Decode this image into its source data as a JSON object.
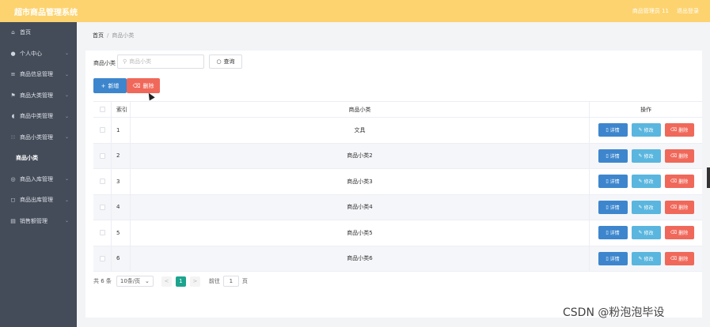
{
  "header": {
    "title": "超市商品管理系统",
    "user": "商品管理员 11",
    "logout": "退出登录",
    "color": "#fdd36f"
  },
  "sidebar": {
    "items": [
      {
        "label": "首页",
        "icon": "home-icon",
        "glyph": "⌂",
        "has_children": false
      },
      {
        "label": "个人中心",
        "icon": "user-icon",
        "glyph": "●",
        "has_children": true
      },
      {
        "label": "商品信息管理",
        "icon": "list-icon",
        "glyph": "≡",
        "has_children": true
      },
      {
        "label": "商品大类管理",
        "icon": "flag-icon",
        "glyph": "⚑",
        "has_children": true
      },
      {
        "label": "商品中类管理",
        "icon": "mic-icon",
        "glyph": "◖",
        "has_children": true
      },
      {
        "label": "商品小类管理",
        "icon": "grid-icon",
        "glyph": "∷",
        "has_children": true
      },
      {
        "label": "商品小类",
        "icon": "",
        "glyph": "",
        "has_children": false,
        "sub": true
      },
      {
        "label": "商品入库管理",
        "icon": "globe-icon",
        "glyph": "◎",
        "has_children": true
      },
      {
        "label": "商品出库管理",
        "icon": "chat-icon",
        "glyph": "◻",
        "has_children": true
      },
      {
        "label": "销售额管理",
        "icon": "clipboard-icon",
        "glyph": "▤",
        "has_children": true
      }
    ]
  },
  "breadcrumb": {
    "home": "首页",
    "separator": "/",
    "current": "商品小类"
  },
  "search": {
    "label": "商品小类",
    "placeholder": "商品小类",
    "query_button": "查询"
  },
  "actions": {
    "add": "新增",
    "delete": "删除"
  },
  "table": {
    "columns": [
      "索引",
      "商品小类",
      "操作"
    ],
    "rows": [
      {
        "index": "1",
        "name": "文具"
      },
      {
        "index": "2",
        "name": "商品小类2"
      },
      {
        "index": "3",
        "name": "商品小类3"
      },
      {
        "index": "4",
        "name": "商品小类4"
      },
      {
        "index": "5",
        "name": "商品小类5"
      },
      {
        "index": "6",
        "name": "商品小类6"
      }
    ],
    "row_actions": {
      "detail": "详情",
      "edit": "修改",
      "remove": "删除"
    }
  },
  "pagination": {
    "total": "共 6 条",
    "page_size": "10条/页",
    "prev": "<",
    "current_page": "1",
    "next": ">",
    "goto_label": "前往",
    "goto_value": "1",
    "goto_suffix": "页"
  },
  "watermark": "CSDN @粉泡泡毕设",
  "colors": {
    "primary": "#3d86cd",
    "info": "#5ab6de",
    "danger": "#f0685a",
    "page_active": "#1ca48f",
    "sidebar": "#444c59"
  }
}
